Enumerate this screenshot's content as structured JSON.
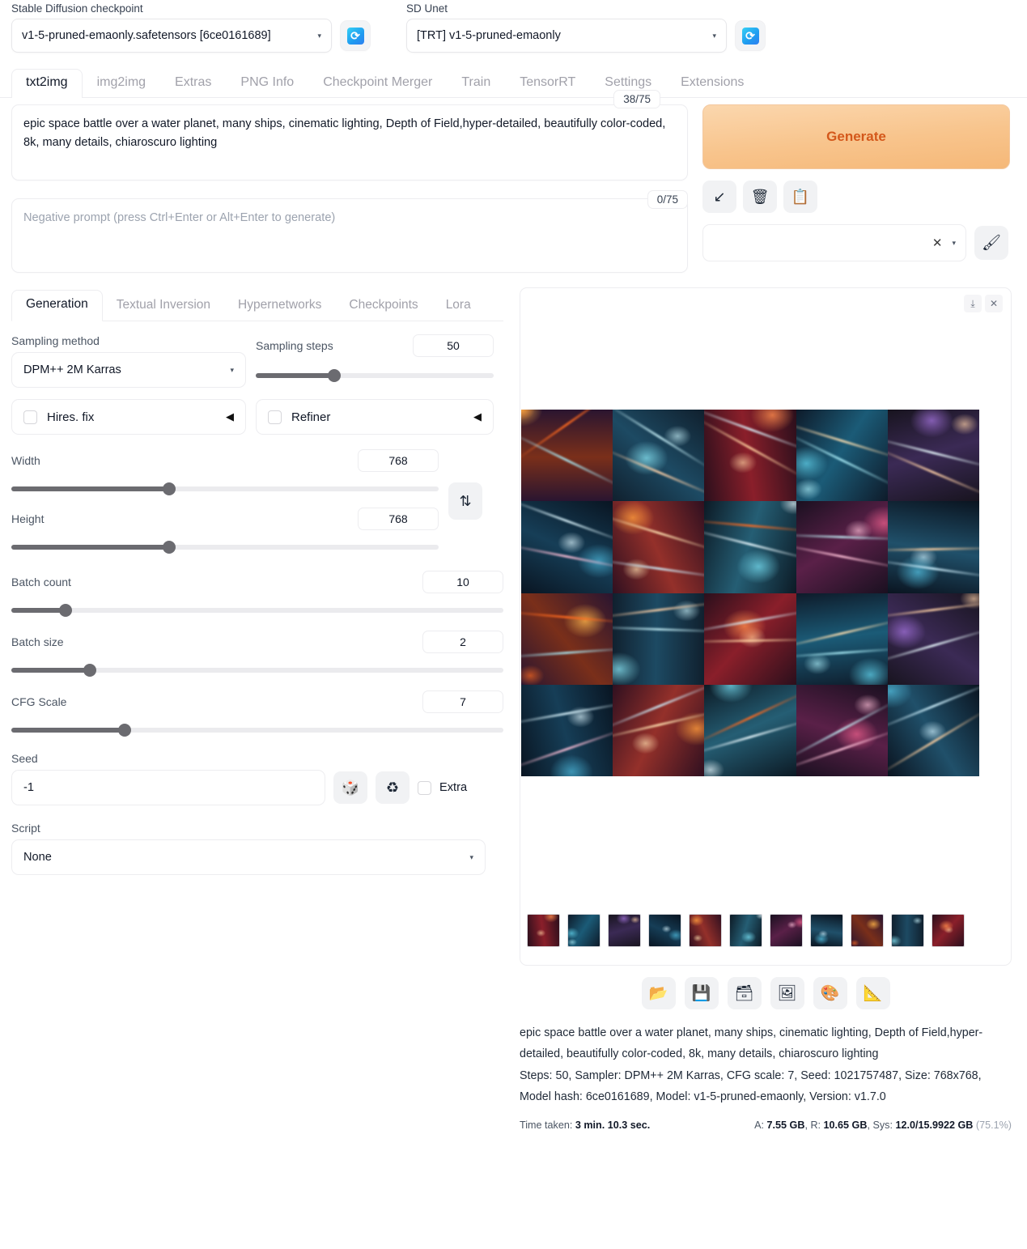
{
  "header": {
    "checkpoint_label": "Stable Diffusion checkpoint",
    "checkpoint_value": "v1-5-pruned-emaonly.safetensors [6ce0161689]",
    "unet_label": "SD Unet",
    "unet_value": "[TRT] v1-5-pruned-emaonly",
    "refresh_icon": "refresh-icon",
    "caret": "▾"
  },
  "main_tabs": [
    {
      "label": "txt2img",
      "active": true
    },
    {
      "label": "img2img",
      "active": false
    },
    {
      "label": "Extras",
      "active": false
    },
    {
      "label": "PNG Info",
      "active": false
    },
    {
      "label": "Checkpoint Merger",
      "active": false
    },
    {
      "label": "Train",
      "active": false
    },
    {
      "label": "TensorRT",
      "active": false
    },
    {
      "label": "Settings",
      "active": false
    },
    {
      "label": "Extensions",
      "active": false
    }
  ],
  "prompt": {
    "positive_value": "epic space battle over a water planet, many ships, cinematic lighting, Depth of Field,hyper-detailed, beautifully color-coded, 8k, many details, chiaroscuro lighting",
    "positive_counter": "38/75",
    "negative_placeholder": "Negative prompt (press Ctrl+Enter or Alt+Enter to generate)",
    "negative_value": "",
    "negative_counter": "0/75"
  },
  "actions": {
    "generate_label": "Generate",
    "arrow_icon": "↙",
    "trash_icon": "🗑",
    "clipboard_icon": "📋",
    "styles_clear": "✕",
    "styles_caret": "▾",
    "brush_icon": "🖌"
  },
  "sub_tabs": [
    {
      "label": "Generation",
      "active": true
    },
    {
      "label": "Textual Inversion",
      "active": false
    },
    {
      "label": "Hypernetworks",
      "active": false
    },
    {
      "label": "Checkpoints",
      "active": false
    },
    {
      "label": "Lora",
      "active": false
    }
  ],
  "generation": {
    "sampling_method_label": "Sampling method",
    "sampling_method_value": "DPM++ 2M Karras",
    "sampling_steps_label": "Sampling steps",
    "sampling_steps_value": "50",
    "sampling_steps_pct": 33,
    "hires_label": "Hires. fix",
    "refiner_label": "Refiner",
    "width_label": "Width",
    "width_value": "768",
    "width_pct": 37,
    "height_label": "Height",
    "height_value": "768",
    "height_pct": 37,
    "batch_count_label": "Batch count",
    "batch_count_value": "10",
    "batch_count_pct": 11,
    "batch_size_label": "Batch size",
    "batch_size_value": "2",
    "batch_size_pct": 16,
    "cfg_label": "CFG Scale",
    "cfg_value": "7",
    "cfg_pct": 23,
    "seed_label": "Seed",
    "seed_value": "-1",
    "dice_icon": "🎲",
    "recycle_icon": "♻",
    "extra_label": "Extra",
    "script_label": "Script",
    "script_value": "None",
    "swap_icon": "⇅",
    "collapse_icon": "◀"
  },
  "output": {
    "download_icon": "⤓",
    "close_icon": "✕",
    "tools": [
      {
        "name": "open-folder-icon",
        "glyph": "📂"
      },
      {
        "name": "save-icon",
        "glyph": "💾"
      },
      {
        "name": "save-zip-icon",
        "glyph": "🗃"
      },
      {
        "name": "send-to-img2img-icon",
        "glyph": "🖼"
      },
      {
        "name": "send-to-inpaint-icon",
        "glyph": "🎨"
      },
      {
        "name": "send-to-extras-icon",
        "glyph": "📐"
      }
    ],
    "info_prompt": "epic space battle over a water planet, many ships, cinematic lighting, Depth of Field,hyper-detailed, beautifully color-coded, 8k, many details, chiaroscuro lighting",
    "info_params": "Steps: 50, Sampler: DPM++ 2M Karras, CFG scale: 7, Seed: 1021757487, Size: 768x768, Model hash: 6ce0161689, Model: v1-5-pruned-emaonly, Version: v1.7.0",
    "time_label": "Time taken:",
    "time_value": "3 min. 10.3 sec.",
    "mem_a_label": "A:",
    "mem_a_value": "7.55 GB",
    "mem_r_label": "R:",
    "mem_r_value": "10.65 GB",
    "mem_sys_label": "Sys:",
    "mem_sys_value": "12.0/15.9922 GB",
    "mem_sys_pct": "(75.1%)",
    "thumbnail_count": 11,
    "grid_rows": 4,
    "grid_cols": 5
  },
  "colors": {
    "generate_bg": "#f8c48c",
    "generate_text": "#d4581b",
    "slider_fill": "#6b6b70",
    "accent_blue": "#1f9bf0"
  }
}
